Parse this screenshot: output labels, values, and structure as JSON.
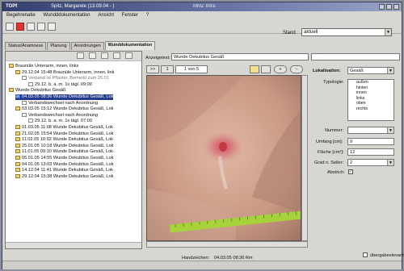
{
  "title_bar": {
    "app": "TOPf",
    "patient": "Spitz, Margarete (13.09.04 - )",
    "module": "MMZ Intra"
  },
  "menu": [
    "Begehrenatie",
    "Wundddokumentation",
    "Ansicht",
    "Fenster",
    "?"
  ],
  "stand": {
    "label": "Stand",
    "value": "aktuell"
  },
  "tabs": [
    "Status/Anamnese",
    "Planung",
    "Anordnungen",
    "Wunddokumentation"
  ],
  "tree": [
    {
      "text": "Braunüle Unterarm, innen, links",
      "level": 0,
      "icon": "folder"
    },
    {
      "text": "29.12.04 15:48 Braunüle Unterarm, innen, link",
      "level": 1,
      "icon": "folder"
    },
    {
      "text": "Verband ist Pflaster, Bemerkt zum 25.01",
      "level": 2,
      "icon": "doc",
      "grey": true
    },
    {
      "text": "29.12. b. a. m. 1x tägl. 09:00",
      "level": 3,
      "icon": "doc"
    },
    {
      "text": "Wunde Dekubitus Gesäß",
      "level": 0,
      "icon": "folder"
    },
    {
      "text": "04.03.05 08:36 Wunde Dekubitus Gesäß, Lok",
      "level": 1,
      "icon": "blue",
      "selected": true
    },
    {
      "text": "Verbandswechsel nach Anordnung",
      "level": 2,
      "icon": "doc"
    },
    {
      "text": "03.03.05 15:12 Wunde Dekubitus Gesäß, Lok",
      "level": 1,
      "icon": "folder"
    },
    {
      "text": "Verbandswechsel nach Anordnung",
      "level": 2,
      "icon": "doc"
    },
    {
      "text": "29.12. b. a. m. 1x tägl. 07:00",
      "level": 3,
      "icon": "doc"
    },
    {
      "text": "01.03.05 11:08 Wunde Dekubitus Gesäß, Lok",
      "level": 1,
      "icon": "folder"
    },
    {
      "text": "21.02.05 15:54 Wunde Dekubitus Gesäß, Lok",
      "level": 1,
      "icon": "folder"
    },
    {
      "text": "11.02.05 10:02 Wunde Dekubitus Gesäß, Lok",
      "level": 1,
      "icon": "folder"
    },
    {
      "text": "25.01.05 10:18 Wunde Dekubitus Gesäß, Lok",
      "level": 1,
      "icon": "folder"
    },
    {
      "text": "11.01.05 09:10 Wunde Dekubitus Gesäß, Lok",
      "level": 1,
      "icon": "folder"
    },
    {
      "text": "05.01.05 14:55 Wunde Dekubitus Gesäß, Lok",
      "level": 1,
      "icon": "folder"
    },
    {
      "text": "04.01.05 13:03 Wunde Dekubitus Gesäß, Lok",
      "level": 1,
      "icon": "folder"
    },
    {
      "text": "14.12.04 11:41 Wunde Dekubitus Gesäß, Lok",
      "level": 1,
      "icon": "folder"
    },
    {
      "text": "29.12.04 15:38 Wunde Dekubitus Gesäß, Lok",
      "level": 1,
      "icon": "folder"
    }
  ],
  "center": {
    "header_label": "Anzeigetext:",
    "header_value": "Wunde Dekubitus Gesäß",
    "nav": {
      "prev": ">>",
      "first": "1",
      "counter": "1 von 5"
    }
  },
  "right": {
    "lokalisation": {
      "label": "Lokalisation:",
      "value": "Gesäß"
    },
    "typologie": {
      "label": "Typologie:",
      "options": [
        "außen",
        "hinten",
        "innen",
        "links",
        "oben",
        "rechts"
      ]
    },
    "nummer": {
      "label": "Nummer:",
      "value": ""
    },
    "umfang": {
      "label": "Umfang [cm]:",
      "value": "9"
    },
    "flaeche": {
      "label": "Fläche [cm²]:",
      "value": "12"
    },
    "grad": {
      "label": "Grad n. Seiler:",
      "value": "2"
    },
    "abstrich": {
      "label": "Abstrich:",
      "checked": true
    },
    "uebergabe": {
      "label": "übergabeelevant",
      "checked": false
    }
  },
  "footer": {
    "label": "Handzeichen:",
    "value": "04.03.05 08:36 Rm"
  }
}
